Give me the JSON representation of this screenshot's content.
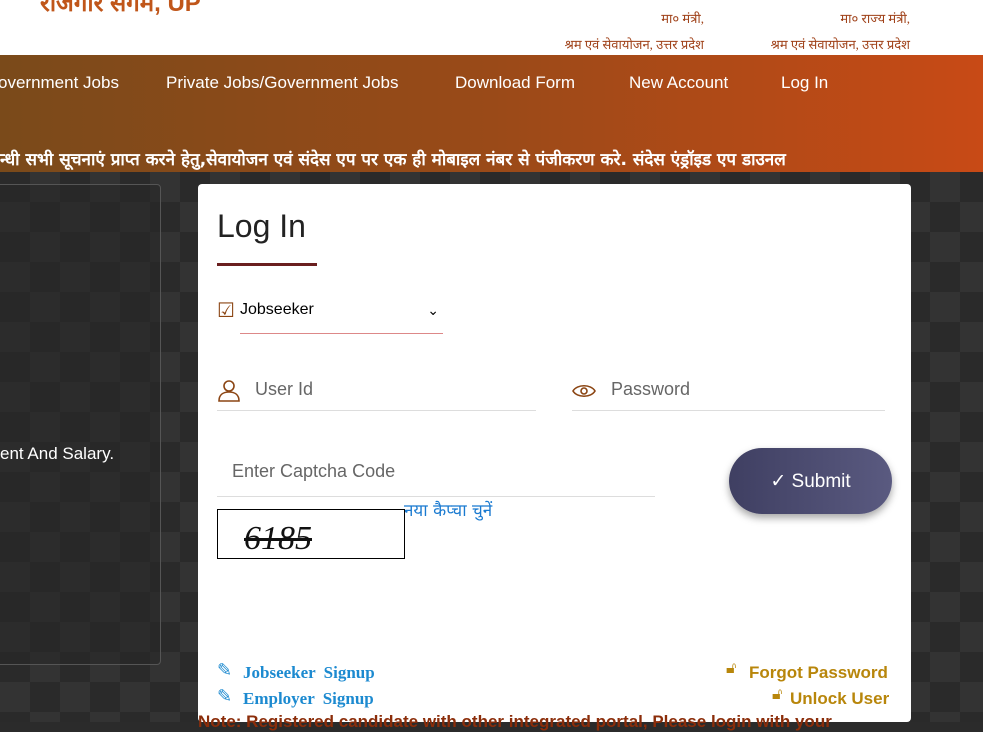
{
  "header": {
    "logo_text": "रोजगार संगम, UP",
    "minister": {
      "title": "मा० मंत्री,",
      "dept": "श्रम एवं सेवायोजन, उत्तर प्रदेश"
    },
    "state_minister": {
      "title": "मा० राज्य मंत्री,",
      "dept": "श्रम एवं सेवायोजन, उत्तर प्रदेश"
    }
  },
  "nav": [
    "overnment Jobs",
    "Private Jobs/Government Jobs",
    "Download Form",
    "New Account",
    "Log In"
  ],
  "ticker": "न्धी सभी सूचनाएं प्राप्त करने हेतु,सेवायोजन एवं संदेस एप पर एक ही मोबाइल नंबर से पंजीकरण करे.   संदेस एंड्रॉइड एप डाउनल",
  "left_panel": {
    "text": "ent And Salary."
  },
  "login": {
    "title": "Log In",
    "user_type": "Jobseeker",
    "userid_placeholder": "User Id",
    "password_placeholder": "Password",
    "captcha_placeholder": "Enter Captcha Code",
    "captcha_image_text": "6185",
    "new_captcha": "नया कैप्चा चुनें",
    "submit": "✓ Submit",
    "jobseeker_signup": "Jobseeker Signup",
    "employer_signup": "Employer Signup",
    "forgot_password": "Forgot Password",
    "unlock_user": "Unlock User",
    "note": "Note: Registered candidate with other integrated portal, Please login with your"
  },
  "colors": {
    "nav_start": "#7a4a1a",
    "nav_end": "#c84a16",
    "link_blue": "#1c8ad0",
    "link_gold": "#b8860b",
    "submit": "#45456a"
  }
}
